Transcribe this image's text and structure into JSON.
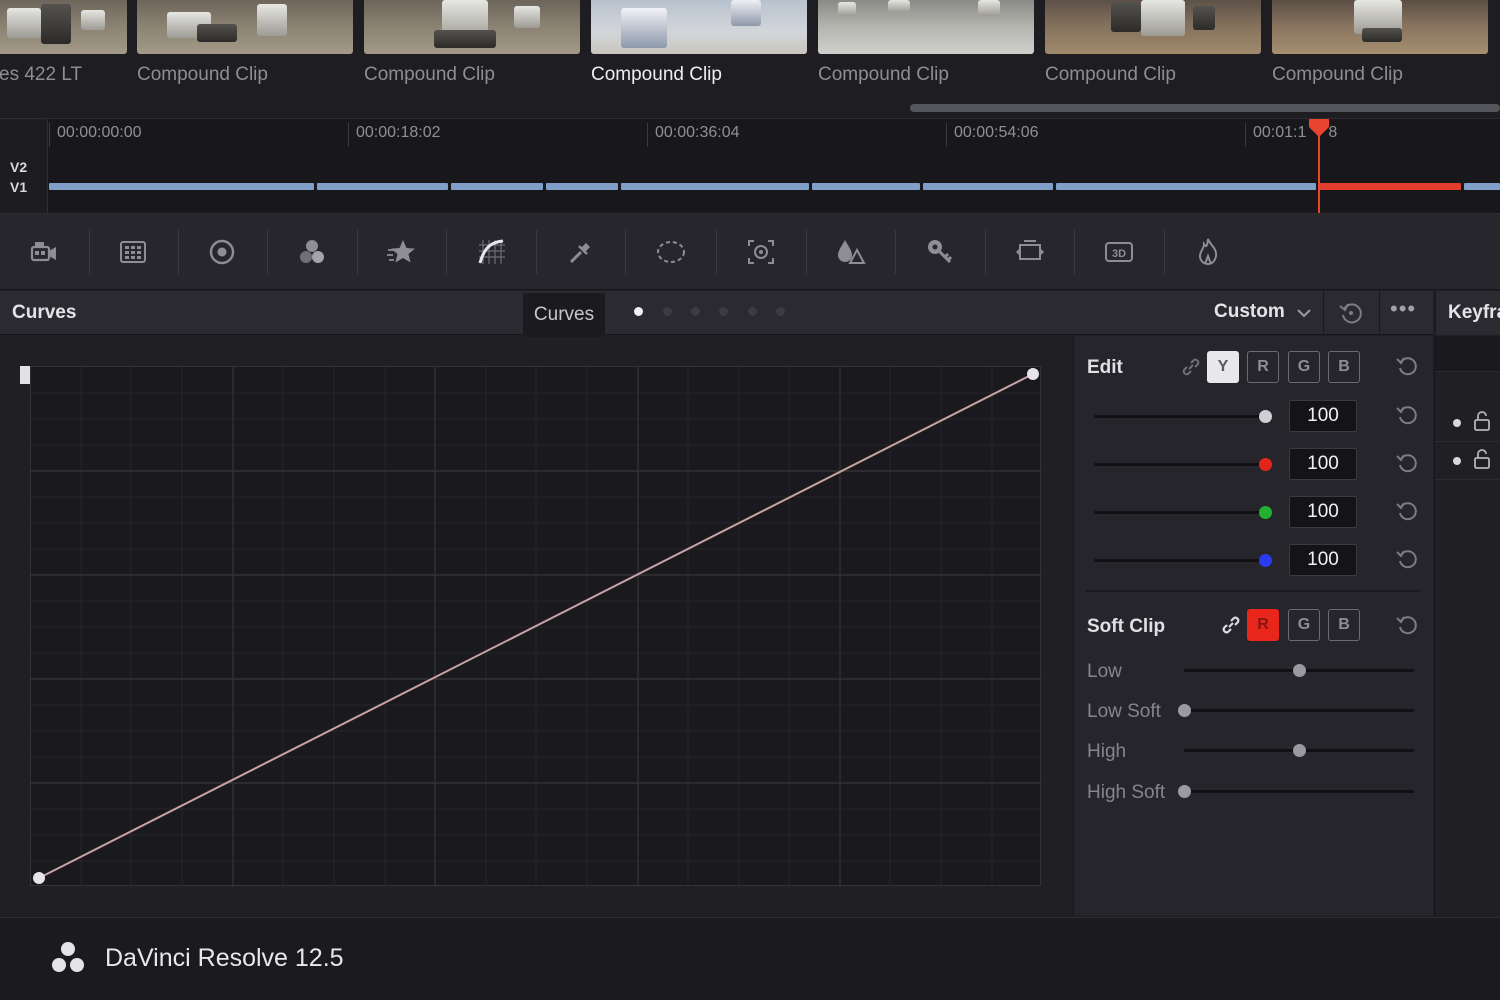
{
  "clips": [
    {
      "name": "es 422 LT",
      "selected": false
    },
    {
      "name": "Compound Clip",
      "selected": false
    },
    {
      "name": "Compound Clip",
      "selected": false
    },
    {
      "name": "Compound Clip",
      "selected": true
    },
    {
      "name": "Compound Clip",
      "selected": false
    },
    {
      "name": "Compound Clip",
      "selected": false
    },
    {
      "name": "Compound Clip",
      "selected": false
    }
  ],
  "timeline": {
    "tracks": [
      "V2",
      "V1"
    ],
    "timecodes": [
      "00:00:00:00",
      "00:00:18:02",
      "00:00:36:04",
      "00:00:54:06",
      "00:01:1"
    ],
    "timecode_tail": "8",
    "playhead_color": "#e9442f"
  },
  "toolbar": {
    "tools": [
      {
        "icon": "camera-raw-icon"
      },
      {
        "icon": "color-match-icon"
      },
      {
        "icon": "color-wheels-icon"
      },
      {
        "icon": "rgb-mixer-icon"
      },
      {
        "icon": "motion-effects-icon"
      },
      {
        "icon": "curves-icon"
      },
      {
        "icon": "qualifier-icon"
      },
      {
        "icon": "window-icon"
      },
      {
        "icon": "tracker-icon"
      },
      {
        "icon": "blur-icon"
      },
      {
        "icon": "key-icon"
      },
      {
        "icon": "sizing-icon"
      },
      {
        "icon": "stereo-3d-icon"
      },
      {
        "icon": "effects-icon"
      }
    ]
  },
  "curves": {
    "title": "Curves",
    "tooltip": "Curves",
    "active_page": 1,
    "page_count": 6,
    "mode": "Custom",
    "curve_color": "#c9a3a3"
  },
  "keyframes": {
    "title": "Keyfra"
  },
  "edit": {
    "label": "Edit",
    "channels": [
      "Y",
      "R",
      "G",
      "B"
    ],
    "active_channel": "Y",
    "sliders": [
      {
        "channel": "Y",
        "value": "100",
        "color": "#d0d0d4"
      },
      {
        "channel": "R",
        "value": "100",
        "color": "#e3241b"
      },
      {
        "channel": "G",
        "value": "100",
        "color": "#22b231"
      },
      {
        "channel": "B",
        "value": "100",
        "color": "#2a3cf0"
      }
    ]
  },
  "soft_clip": {
    "label": "Soft Clip",
    "channels": [
      "R",
      "G",
      "B"
    ],
    "active_channel": "R",
    "rows": [
      {
        "label": "Low",
        "level": 0.5
      },
      {
        "label": "Low Soft",
        "level": 0.0
      },
      {
        "label": "High",
        "level": 0.5
      },
      {
        "label": "High Soft",
        "level": 0.0
      }
    ]
  },
  "footer": {
    "app_name": "DaVinci Resolve 12.5"
  }
}
